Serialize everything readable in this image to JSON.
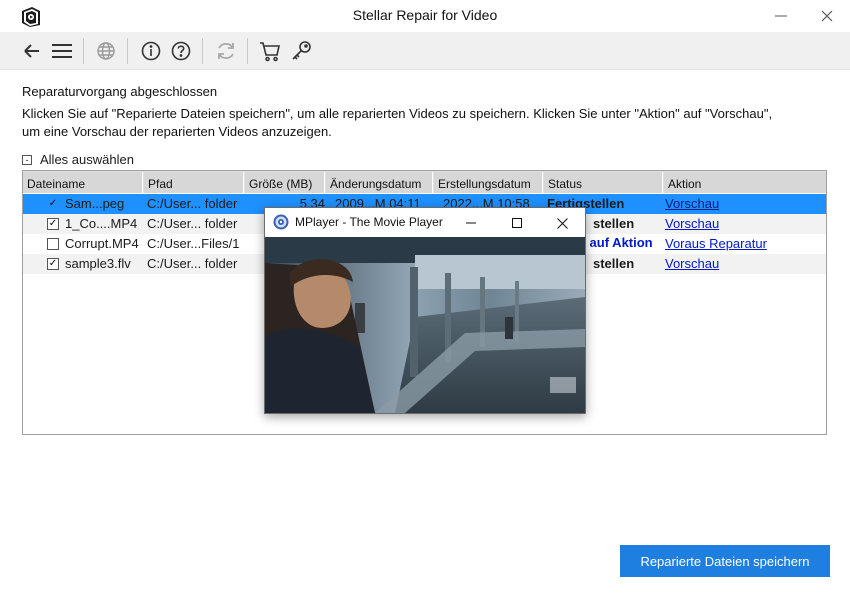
{
  "window": {
    "title": "Stellar Repair for Video"
  },
  "toolbar": {
    "icons": [
      "back-arrow-icon",
      "menu-icon",
      "globe-icon",
      "info-icon",
      "help-icon",
      "refresh-icon",
      "cart-icon",
      "key-icon"
    ]
  },
  "content": {
    "heading": "Reparaturvorgang abgeschlossen",
    "description": "Klicken Sie auf \"Reparierte Dateien speichern\", um alle reparierten Videos zu speichern. Klicken Sie unter \"Aktion\" auf \"Vorschau\", um eine Vorschau der reparierten Videos anzuzeigen.",
    "select_all_label": "Alles auswählen",
    "select_all_mark": "-"
  },
  "table": {
    "headers": [
      "Dateiname",
      "Pfad",
      "Größe (MB)",
      "Änderungsdatum",
      "Erstellungsdatum",
      "Status",
      "Aktion"
    ],
    "rows": [
      {
        "checked": true,
        "mark": "✓",
        "name": "Sam...peg",
        "path": "C:/User... folder",
        "size": "5.34",
        "modified": "2009...M 04:11",
        "created": "2022...M 10:58",
        "status": "Fertigstellen",
        "action": "Vorschau"
      },
      {
        "checked": true,
        "mark": "✓",
        "name": "1_Co....MP4",
        "path": "C:/User... folder",
        "size": "",
        "modified": "",
        "created": "",
        "status": "stellen",
        "action": "Vorschau"
      },
      {
        "checked": false,
        "mark": "",
        "name": "Corrupt.MP4",
        "path": "C:/User...Files/1",
        "size": "",
        "modified": "",
        "created": "",
        "status": "n auf Aktion",
        "action": "Voraus Reparatur"
      },
      {
        "checked": true,
        "mark": "✓",
        "name": "sample3.flv",
        "path": "C:/User... folder",
        "size": "",
        "modified": "",
        "created": "",
        "status": "stellen",
        "action": "Vorschau"
      }
    ]
  },
  "mplayer": {
    "title": "MPlayer - The Movie Player"
  },
  "footer": {
    "save_label": "Reparierte Dateien speichern"
  },
  "colors": {
    "accent": "#1e7fe0",
    "selection": "#1e90ff",
    "link": "#0019c8",
    "toolbar_bg": "#f0f0f0"
  }
}
